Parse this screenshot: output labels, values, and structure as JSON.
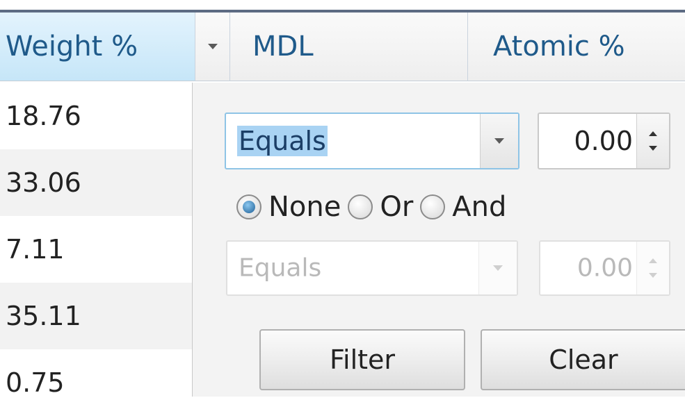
{
  "columns": {
    "weight": "Weight %",
    "mdl": "MDL",
    "atomic": "Atomic %"
  },
  "weight_values": [
    "18.76",
    "33.06",
    "7.11",
    "35.11",
    "0.75"
  ],
  "filter": {
    "operator1": "Equals",
    "value1": "0.00",
    "logic_options": [
      "None",
      "Or",
      "And"
    ],
    "logic_selected": "None",
    "operator2": "Equals",
    "value2": "0.00",
    "filter_label": "Filter",
    "clear_label": "Clear"
  },
  "icons": {
    "column_menu": "chevron-down-icon",
    "spin_up": "caret-up-icon",
    "spin_down": "caret-down-icon"
  },
  "colors": {
    "header_accent": "#1f5a8a",
    "selected_header_bg": "#c6e6f8",
    "focus_border": "#8ec4e6",
    "selection_highlight": "#a9d3f3"
  }
}
